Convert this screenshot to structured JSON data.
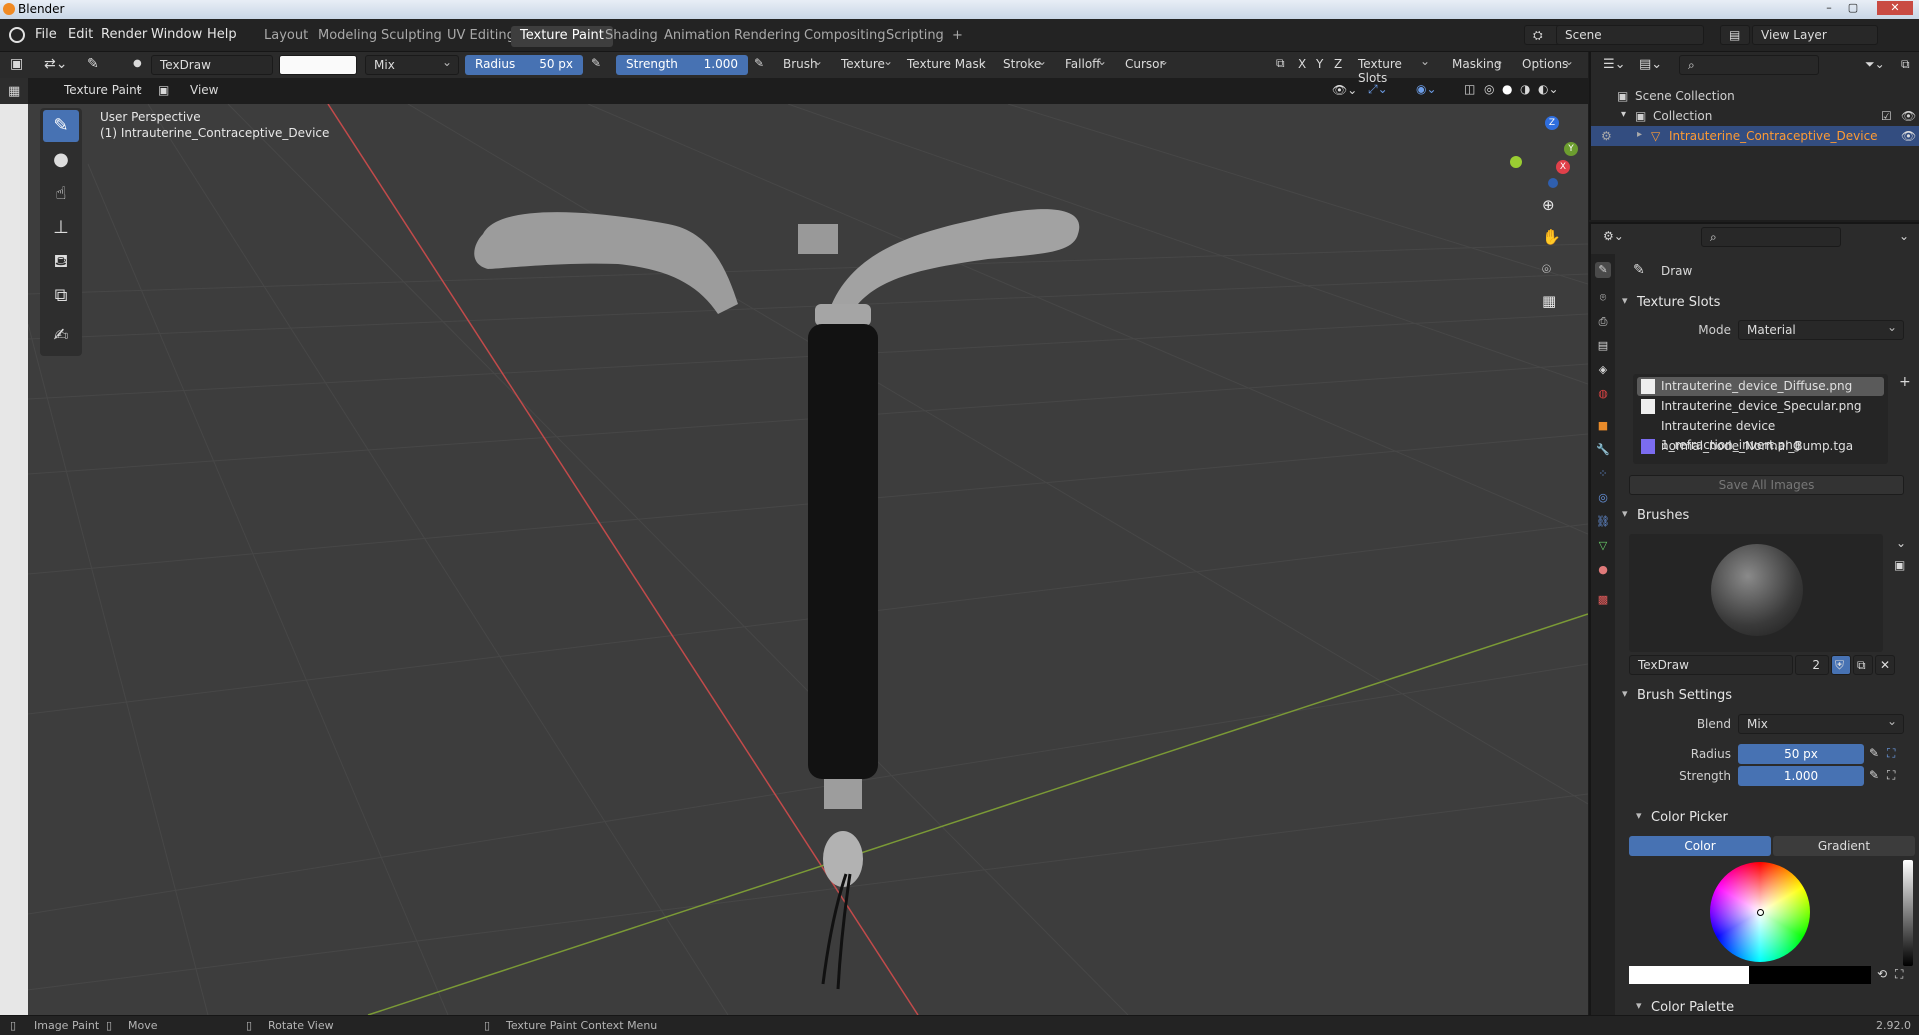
{
  "window": {
    "title": "Blender",
    "min": "–",
    "max": "▢",
    "close": "✕"
  },
  "menu": [
    "File",
    "Edit",
    "Render",
    "Window",
    "Help"
  ],
  "workspaces": [
    "Layout",
    "Modeling",
    "Sculpting",
    "UV Editing",
    "Texture Paint",
    "Shading",
    "Animation",
    "Rendering",
    "Compositing",
    "Scripting",
    "+"
  ],
  "scene": {
    "name": "Scene",
    "view_layer": "View Layer"
  },
  "tool_header": {
    "brush_name": "TexDraw",
    "blend": "Mix",
    "radius_label": "Radius",
    "radius_value": "50 px",
    "strength_label": "Strength",
    "strength_value": "1.000",
    "menus": [
      "Brush",
      "Texture",
      "Texture Mask",
      "Stroke",
      "Falloff",
      "Cursor"
    ],
    "axes": [
      "X",
      "Y",
      "Z"
    ],
    "right_menus": [
      "Texture Slots",
      "Masking",
      "Options"
    ]
  },
  "viewport_header": {
    "mode": "Texture Paint",
    "view": "View"
  },
  "viewport": {
    "perspective": "User Perspective",
    "object": "(1) Intrauterine_Contraceptive_Device",
    "gizmo": {
      "x": "X",
      "y": "Y",
      "z": "Z"
    }
  },
  "outliner": {
    "scene_collection": "Scene Collection",
    "collection": "Collection",
    "object": "Intrauterine_Contraceptive_Device"
  },
  "properties": {
    "tool": "Draw",
    "texture_slots": {
      "title": "Texture Slots",
      "mode_label": "Mode",
      "mode_value": "Material",
      "slots": [
        "Intrauterine_device_Diffuse.png",
        "Intrauterine_device_Specular.png",
        "Intrauterine device 1_refraction_invert.png",
        "normal_node_Normal_Bump.tga"
      ],
      "save_all": "Save All Images"
    },
    "brushes": {
      "title": "Brushes",
      "name": "TexDraw",
      "users": "2"
    },
    "brush_settings": {
      "title": "Brush Settings",
      "blend_label": "Blend",
      "blend_value": "Mix",
      "radius_label": "Radius",
      "radius_value": "50 px",
      "strength_label": "Strength",
      "strength_value": "1.000"
    },
    "color_picker": {
      "title": "Color Picker",
      "tab_color": "Color",
      "tab_gradient": "Gradient"
    },
    "color_palette": {
      "title": "Color Palette"
    }
  },
  "statusbar": {
    "image_paint": "Image Paint",
    "move": "Move",
    "rotate": "Rotate View",
    "context": "Texture Paint Context Menu",
    "version": "2.92.0"
  },
  "colors": {
    "accent": "#4772b3",
    "selected_text": "#ff9b33",
    "viewport_bg": "#3d3d3d"
  }
}
